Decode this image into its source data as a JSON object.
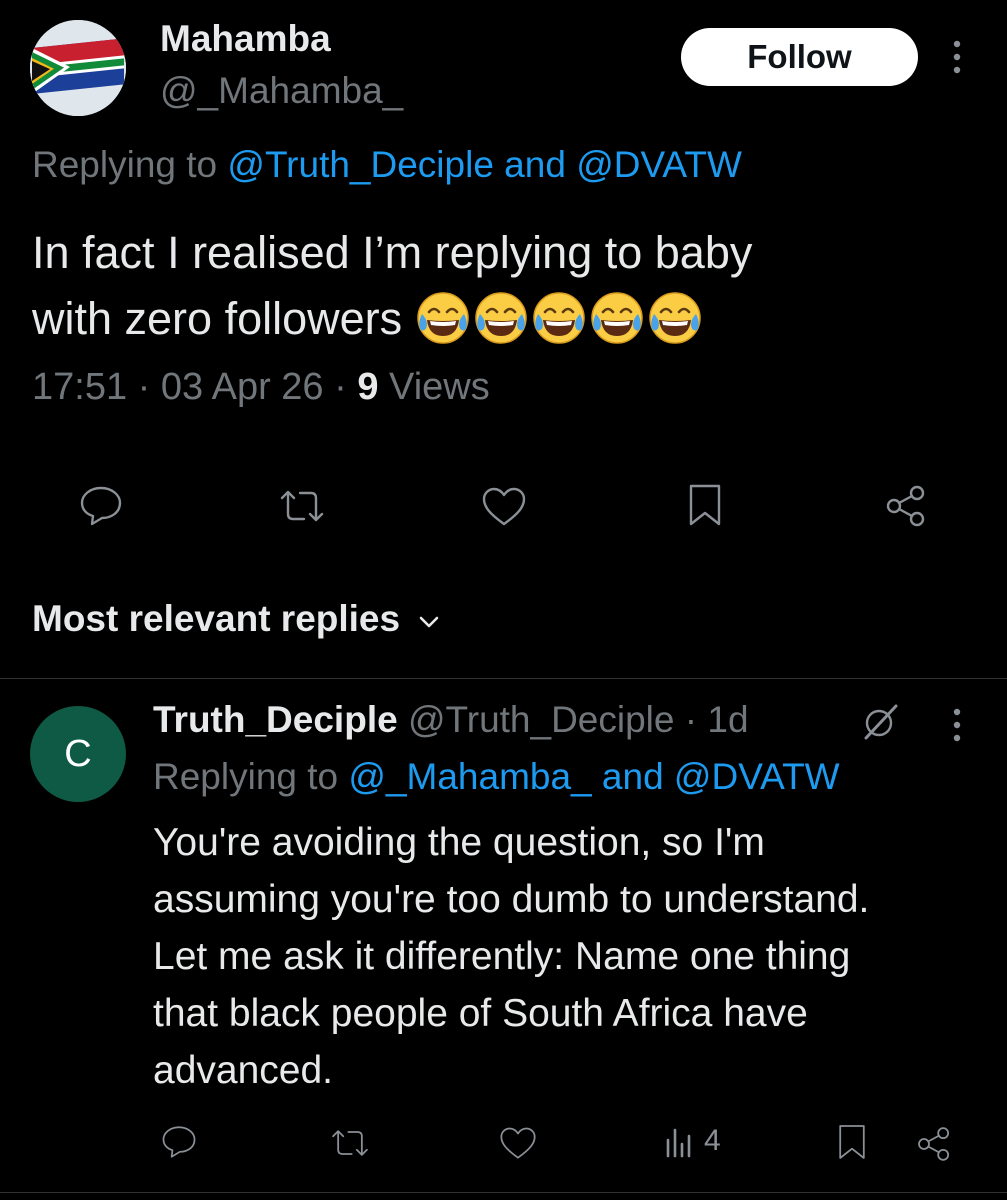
{
  "post": {
    "display_name": "Mahamba",
    "handle": "@_Mahamba_",
    "follow_label": "Follow",
    "replying_prefix": "Replying to",
    "replying_users": "@Truth_Deciple and @DVATW",
    "text_line1": "In fact I realised I’m replying to baby",
    "text_line2": "with zero followers",
    "emoji": "face-with-tears-of-joy",
    "time": "17:51",
    "date": "03 Apr 26",
    "views_count": "9",
    "views_label": "Views"
  },
  "replies_section": {
    "title": "Most relevant replies"
  },
  "reply": {
    "avatar_letter": "C",
    "display_name": "Truth_Deciple",
    "handle": "@Truth_Deciple",
    "age": "1d",
    "replying_prefix": "Replying to",
    "replying_users": "@_Mahamba_ and @DVATW",
    "text_lines": [
      "You're avoiding the question, so I'm",
      "assuming you're too dumb to understand.",
      "Let me ask it differently: Name one thing",
      "that black people of South Africa have",
      "advanced."
    ],
    "views_count": "4"
  },
  "colors": {
    "background": "#000000",
    "text": "#e7e9ea",
    "muted": "#71767b",
    "link": "#1d9bf0",
    "avatar_reply": "#0e5a44"
  }
}
